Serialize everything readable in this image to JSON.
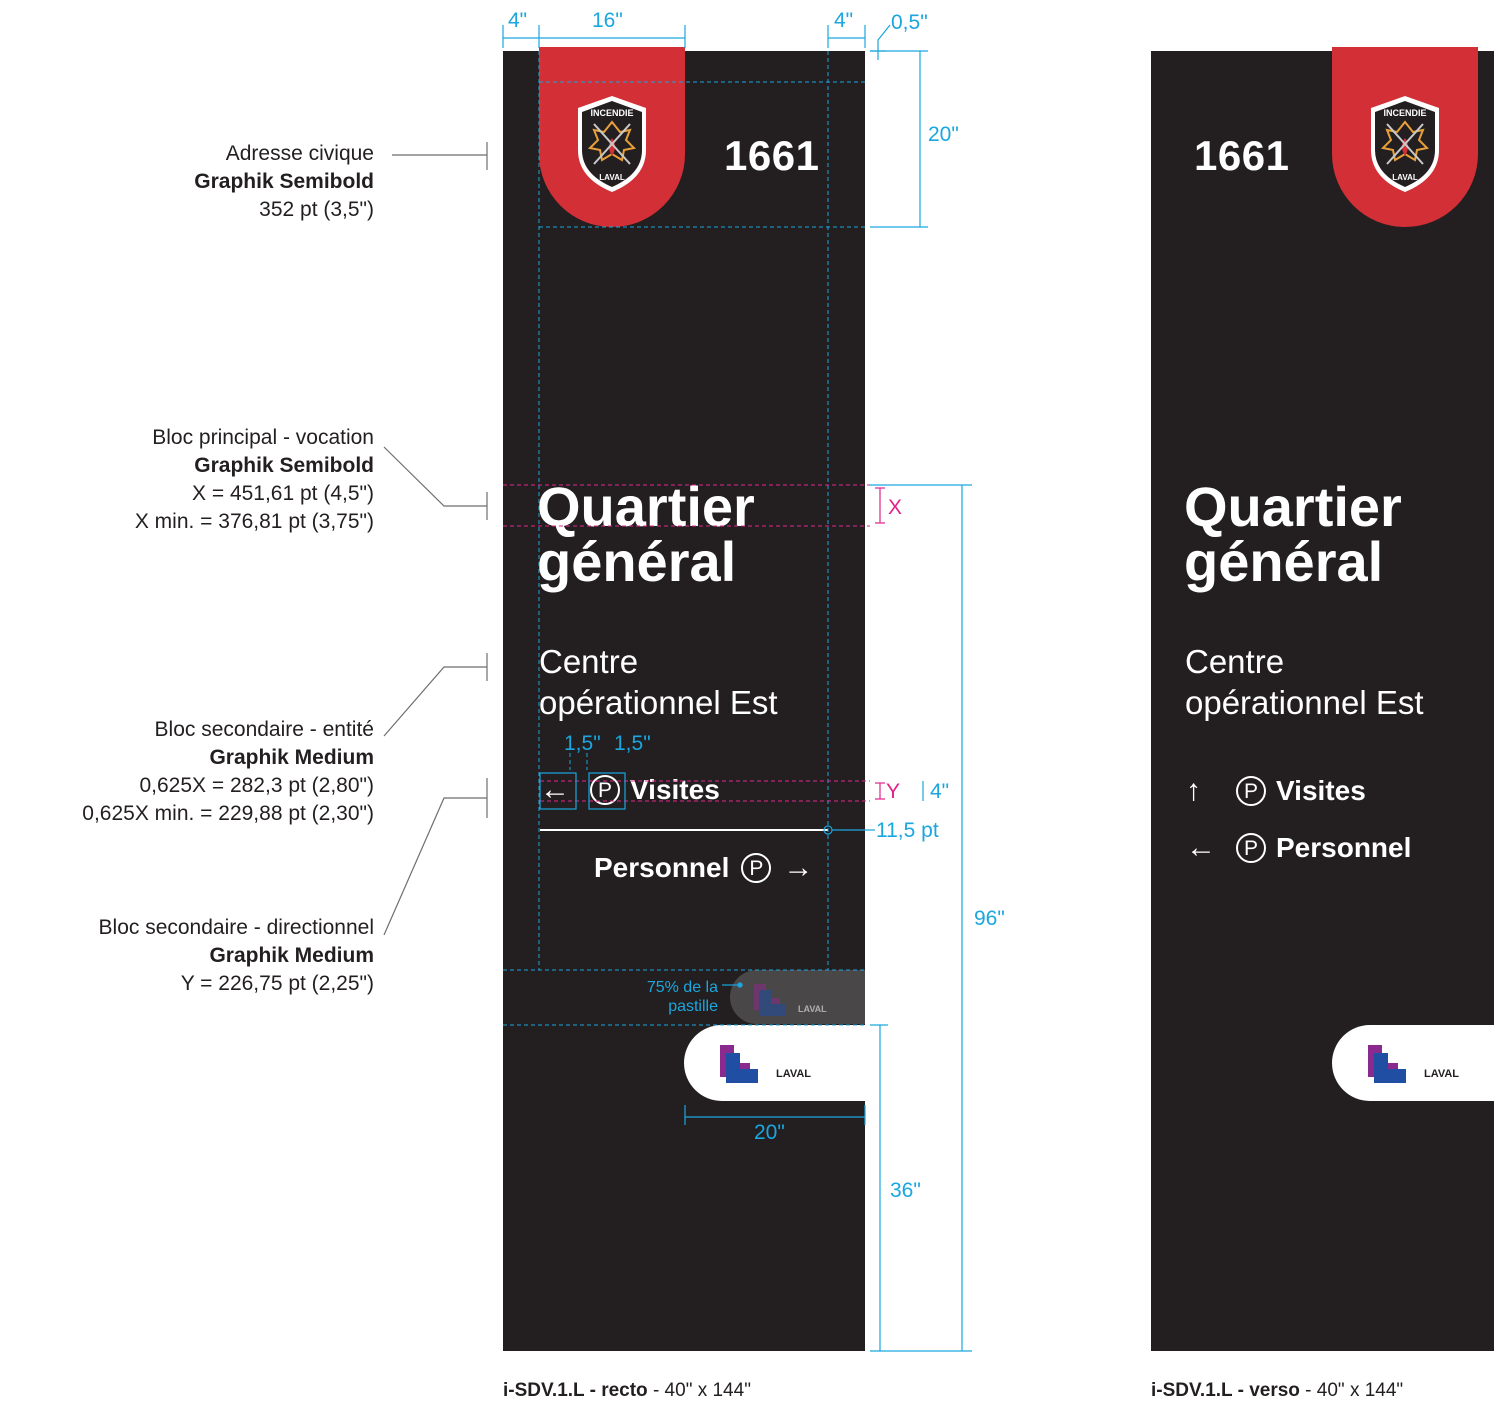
{
  "dimensions": {
    "top_left_margin": "4\"",
    "top_width": "16\"",
    "top_right_margin": "4\"",
    "top_offset": "0,5\"",
    "shield_height": "20\"",
    "x_marker": "X",
    "y_marker": "Y",
    "arrow_spacing_1": "1,5\"",
    "arrow_spacing_2": "1,5\"",
    "line_height_4": "4\"",
    "rule_weight": "11,5 pt",
    "total_height": "96\"",
    "pastille_note": "75% de la pastille",
    "pastille_width": "20\"",
    "base_height": "36\""
  },
  "annotations": [
    {
      "line1": "Adresse civique",
      "line2": "Graphik Semibold",
      "line3": "352 pt (3,5\")",
      "line4": ""
    },
    {
      "line1": "Bloc principal - vocation",
      "line2": "Graphik Semibold",
      "line3": "X = 451,61 pt (4,5\")",
      "line4": "X min. = 376,81 pt (3,75\")"
    },
    {
      "line1": "Bloc secondaire - entité",
      "line2": "Graphik Medium",
      "line3": "0,625X = 282,3 pt (2,80\")",
      "line4": "0,625X min. = 229,88 pt (2,30\")"
    },
    {
      "line1": "Bloc secondaire - directionnel",
      "line2": "Graphik Medium",
      "line3": "Y = 226,75 pt (2,25\")",
      "line4": ""
    }
  ],
  "recto": {
    "address": "1661",
    "title_line1": "Quartier",
    "title_line2": "général",
    "entity_line1": "Centre",
    "entity_line2": "opérationnel Est",
    "dir1_arrow": "←",
    "dir1_p": "P",
    "dir1_label": "Visites",
    "dir2_label": "Personnel",
    "dir2_p": "P",
    "dir2_arrow": "→",
    "caption_bold": "i-SDV.1.L - recto",
    "caption_rest": " - 40\" x 144\""
  },
  "verso": {
    "address": "1661",
    "title_line1": "Quartier",
    "title_line2": "général",
    "entity_line1": "Centre",
    "entity_line2": "opérationnel Est",
    "dir1_arrow": "↑",
    "dir1_p": "P",
    "dir1_label": "Visites",
    "dir2_arrow": "←",
    "dir2_p": "P",
    "dir2_label": "Personnel",
    "caption_bold": "i-SDV.1.L - verso",
    "caption_rest": " - 40\" x 144\""
  },
  "logos": {
    "shield_top": "INCENDIE",
    "shield_bottom": "LAVAL",
    "city_logo": "LAVAL"
  },
  "colors": {
    "panel": "#231f20",
    "shield_red": "#d22f36",
    "dimension_blue": "#1aa6df",
    "guide_magenta": "#e0248a",
    "logo_blue": "#1f4ea3",
    "logo_purple": "#8a2a8e"
  }
}
